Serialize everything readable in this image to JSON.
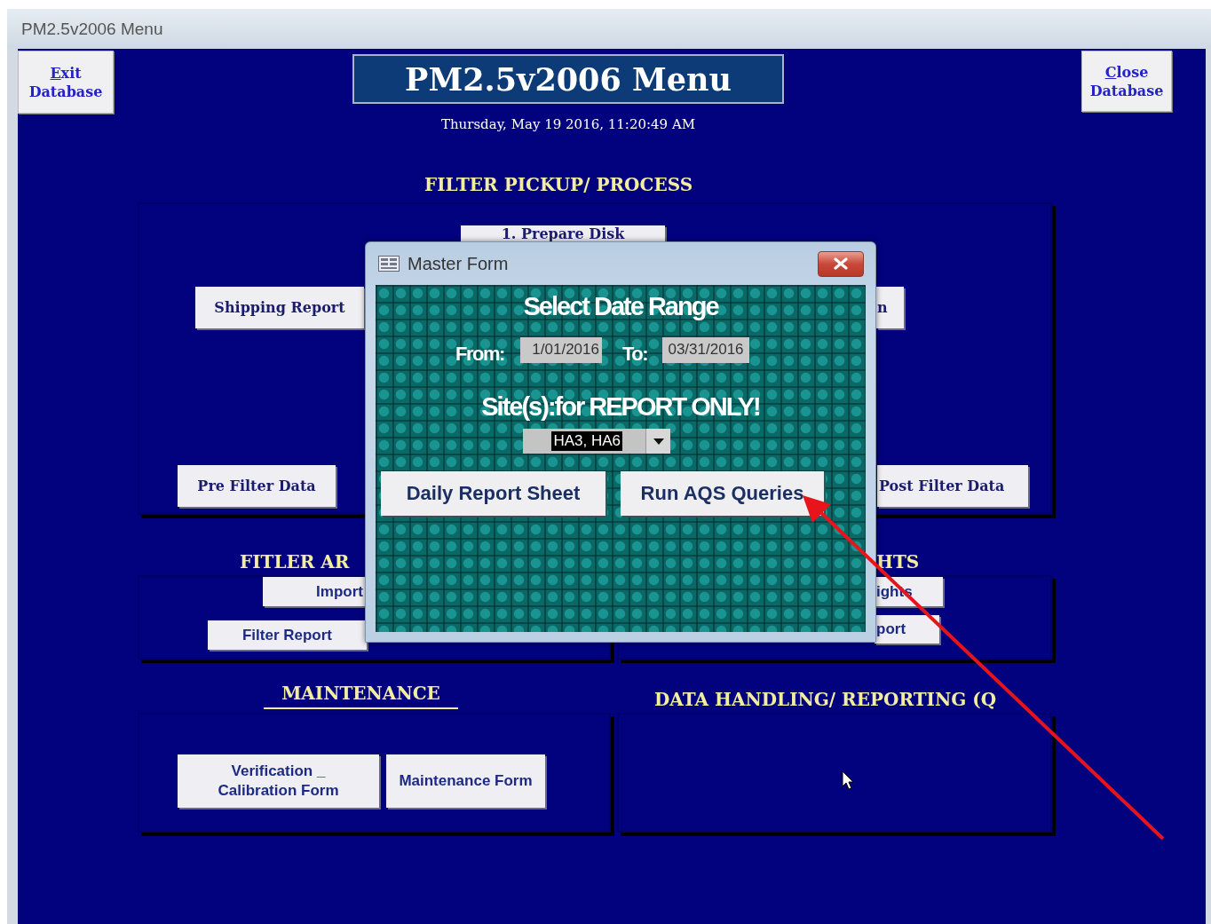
{
  "window": {
    "title": "PM2.5v2006 Menu"
  },
  "exit_button": {
    "key": "E",
    "rest": "xit",
    "line2": "Database"
  },
  "close_button": {
    "key": "C",
    "rest": "lose",
    "line2": "Database"
  },
  "form_title": "PM2.5v2006 Menu",
  "date_time": "Thursday, May 19 2016, 11:20:49 AM",
  "filter_pickup": {
    "heading": "FILTER PICKUP/ PROCESS",
    "buttons": [
      "1. Prepare Disk",
      "Shipping Report",
      "n",
      "Pre Filter Data",
      "Post Filter Data"
    ]
  },
  "filter_archive": {
    "heading": "FITLER AR",
    "buttons": [
      "Import",
      "Filter Report"
    ]
  },
  "weights": {
    "heading": "HTS",
    "buttons": [
      "ights",
      "port"
    ]
  },
  "maintenance": {
    "heading": "MAINTENANCE",
    "buttons": [
      "Verification _\nCalibration Form",
      "Maintenance Form"
    ]
  },
  "data_handling": {
    "heading": "DATA HANDLING/ REPORTING (Q"
  },
  "dialog": {
    "title": "Master Form",
    "heading": "Select Date Range",
    "from_label": "From:",
    "from_value": "1/01/2016",
    "to_label": "To:",
    "to_value": "03/31/2016",
    "sites_label": "Site(s):for REPORT ONLY!",
    "sites_value": "HA3, HA6",
    "buttons": [
      "Daily Report Sheet",
      "Run AQS Queries"
    ]
  }
}
